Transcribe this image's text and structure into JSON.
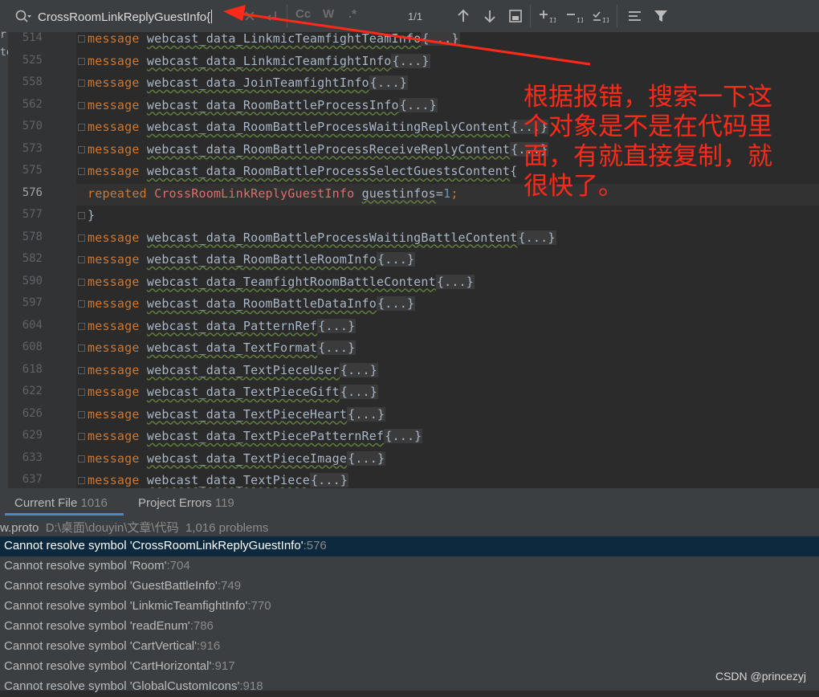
{
  "search": {
    "query": "CrossRoomLinkReplyGuestInfo{",
    "match_count": "1/1",
    "cc_label": "Cc",
    "w_label": "W",
    "regex_label": ".*"
  },
  "left_strip_chars": [
    "rr",
    "to"
  ],
  "editor": {
    "lines": [
      {
        "num": "514",
        "kw": "message",
        "name": "webcast_data_LinkmicTeamfightTeamInfo",
        "tail": "{...}"
      },
      {
        "num": "525",
        "kw": "message",
        "name": "webcast_data_LinkmicTeamfightInfo",
        "tail": "{...}"
      },
      {
        "num": "558",
        "kw": "message",
        "name": "webcast_data_JoinTeamfightInfo",
        "tail": "{...}"
      },
      {
        "num": "562",
        "kw": "message",
        "name": "webcast_data_RoomBattleProcessInfo",
        "tail": "{...}"
      },
      {
        "num": "570",
        "kw": "message",
        "name": "webcast_data_RoomBattleProcessWaitingReplyContent",
        "tail": "{...}"
      },
      {
        "num": "573",
        "kw": "message",
        "name": "webcast_data_RoomBattleProcessReceiveReplyContent",
        "tail": "{...}"
      },
      {
        "num": "575",
        "kw": "message",
        "name": "webcast_data_RoomBattleProcessSelectGuestsContent",
        "tail": "{"
      },
      {
        "num": "576",
        "kw": "repeated",
        "name": "CrossRoomLinkReplyGuestInfo",
        "field": "guestinfos",
        "eq": "=",
        "val": "1",
        "semi": ";"
      },
      {
        "num": "577",
        "kw": "",
        "name": "}",
        "tail": ""
      },
      {
        "num": "578",
        "kw": "message",
        "name": "webcast_data_RoomBattleProcessWaitingBattleContent",
        "tail": "{...}"
      },
      {
        "num": "582",
        "kw": "message",
        "name": "webcast_data_RoomBattleRoomInfo",
        "tail": "{...}"
      },
      {
        "num": "590",
        "kw": "message",
        "name": "webcast_data_TeamfightRoomBattleContent",
        "tail": "{...}"
      },
      {
        "num": "597",
        "kw": "message",
        "name": "webcast_data_RoomBattleDataInfo",
        "tail": "{...}"
      },
      {
        "num": "604",
        "kw": "message",
        "name": "webcast_data_PatternRef",
        "tail": "{...}"
      },
      {
        "num": "608",
        "kw": "message",
        "name": "webcast_data_TextFormat",
        "tail": "{...}"
      },
      {
        "num": "618",
        "kw": "message",
        "name": "webcast_data_TextPieceUser",
        "tail": "{...}"
      },
      {
        "num": "622",
        "kw": "message",
        "name": "webcast_data_TextPieceGift",
        "tail": "{...}"
      },
      {
        "num": "626",
        "kw": "message",
        "name": "webcast_data_TextPieceHeart",
        "tail": "{...}"
      },
      {
        "num": "629",
        "kw": "message",
        "name": "webcast_data_TextPiecePatternRef",
        "tail": "{...}"
      },
      {
        "num": "633",
        "kw": "message",
        "name": "webcast_data_TextPieceImage",
        "tail": "{...}"
      },
      {
        "num": "637",
        "kw": "message",
        "name": "webcast_data_TextPiece",
        "tail": "{...}"
      }
    ]
  },
  "annotation": {
    "text": "根据报错，搜索一下这个对象是不是在代码里面，有就直接复制，就很快了。",
    "color": "#ff2a1a"
  },
  "problems": {
    "tabs": [
      {
        "label": "Current File",
        "count": "1016"
      },
      {
        "label": "Project Errors",
        "count": "119"
      }
    ],
    "file_name": "w.proto",
    "file_path": "D:\\桌面\\douyin\\文章\\代码",
    "file_count": "1,016 problems",
    "items": [
      {
        "text": "Cannot resolve symbol 'CrossRoomLinkReplyGuestInfo'",
        "line": ":576"
      },
      {
        "text": "Cannot resolve symbol 'Room'",
        "line": ":704"
      },
      {
        "text": "Cannot resolve symbol 'GuestBattleInfo'",
        "line": ":749"
      },
      {
        "text": "Cannot resolve symbol 'LinkmicTeamfightInfo'",
        "line": ":770"
      },
      {
        "text": "Cannot resolve symbol 'readEnum'",
        "line": ":786"
      },
      {
        "text": "Cannot resolve symbol 'CartVertical'",
        "line": ":916"
      },
      {
        "text": "Cannot resolve symbol 'CartHorizontal'",
        "line": ":917"
      },
      {
        "text": "Cannot resolve symbol 'GlobalCustomIcons'",
        "line": ":918"
      }
    ]
  },
  "watermark": "CSDN @princezyj"
}
